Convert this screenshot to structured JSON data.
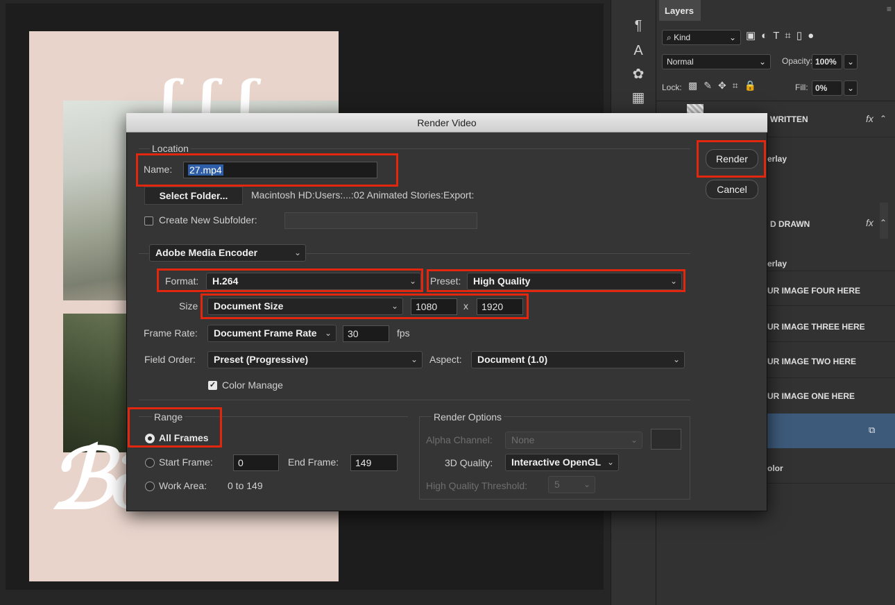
{
  "dialog": {
    "title": "Render Video",
    "location": {
      "group_label": "Location",
      "name_label": "Name:",
      "name_value": "27.mp4",
      "select_folder_label": "Select Folder...",
      "folder_path": "Macintosh HD:Users:...:02 Animated Stories:Export:",
      "subfolder_label": "Create New Subfolder:",
      "subfolder_value": ""
    },
    "encoder": {
      "selected": "Adobe Media Encoder"
    },
    "format": {
      "label": "Format:",
      "value": "H.264"
    },
    "preset": {
      "label": "Preset:",
      "value": "High Quality"
    },
    "size": {
      "label": "Size",
      "value": "Document Size",
      "width": "1080",
      "x_label": "x",
      "height": "1920"
    },
    "frame_rate": {
      "label": "Frame Rate:",
      "value": "Document Frame Rate",
      "fps_value": "30",
      "fps_label": "fps"
    },
    "field_order": {
      "label": "Field Order:",
      "value": "Preset (Progressive)"
    },
    "aspect": {
      "label": "Aspect:",
      "value": "Document (1.0)"
    },
    "color_manage": {
      "label": "Color Manage",
      "checked": true
    },
    "range": {
      "group_label": "Range",
      "all_frames_label": "All Frames",
      "start_frame_label": "Start Frame:",
      "start_frame_value": "0",
      "end_frame_label": "End Frame:",
      "end_frame_value": "149",
      "work_area_label": "Work Area:",
      "work_area_value": "0 to 149",
      "selected": "All Frames"
    },
    "render_options": {
      "group_label": "Render Options",
      "alpha_label": "Alpha Channel:",
      "alpha_value": "None",
      "quality_label": "3D Quality:",
      "quality_value": "Interactive OpenGL",
      "threshold_label": "High Quality Threshold:",
      "threshold_value": "5"
    },
    "buttons": {
      "render": "Render",
      "cancel": "Cancel"
    }
  },
  "layers_panel": {
    "tab": "Layers",
    "filter_kind": "Kind",
    "blend_mode": "Normal",
    "opacity_label": "Opacity:",
    "opacity_value": "100%",
    "lock_label": "Lock:",
    "fill_label": "Fill:",
    "fill_value": "0%",
    "layers": [
      {
        "name": "WRITTEN",
        "fx": "fx"
      },
      {
        "name": "erlay"
      },
      {
        "name": "D DRAWN",
        "fx": "fx"
      },
      {
        "name": "erlay"
      },
      {
        "name": "UR IMAGE FOUR HERE"
      },
      {
        "name": "UR IMAGE THREE HERE"
      },
      {
        "name": "UR IMAGE TWO HERE"
      },
      {
        "name": "UR IMAGE ONE HERE"
      },
      {
        "name": "olor"
      }
    ]
  },
  "colors": {
    "highlight": "#e3260e",
    "selected_layer": "#3d5a7a"
  }
}
